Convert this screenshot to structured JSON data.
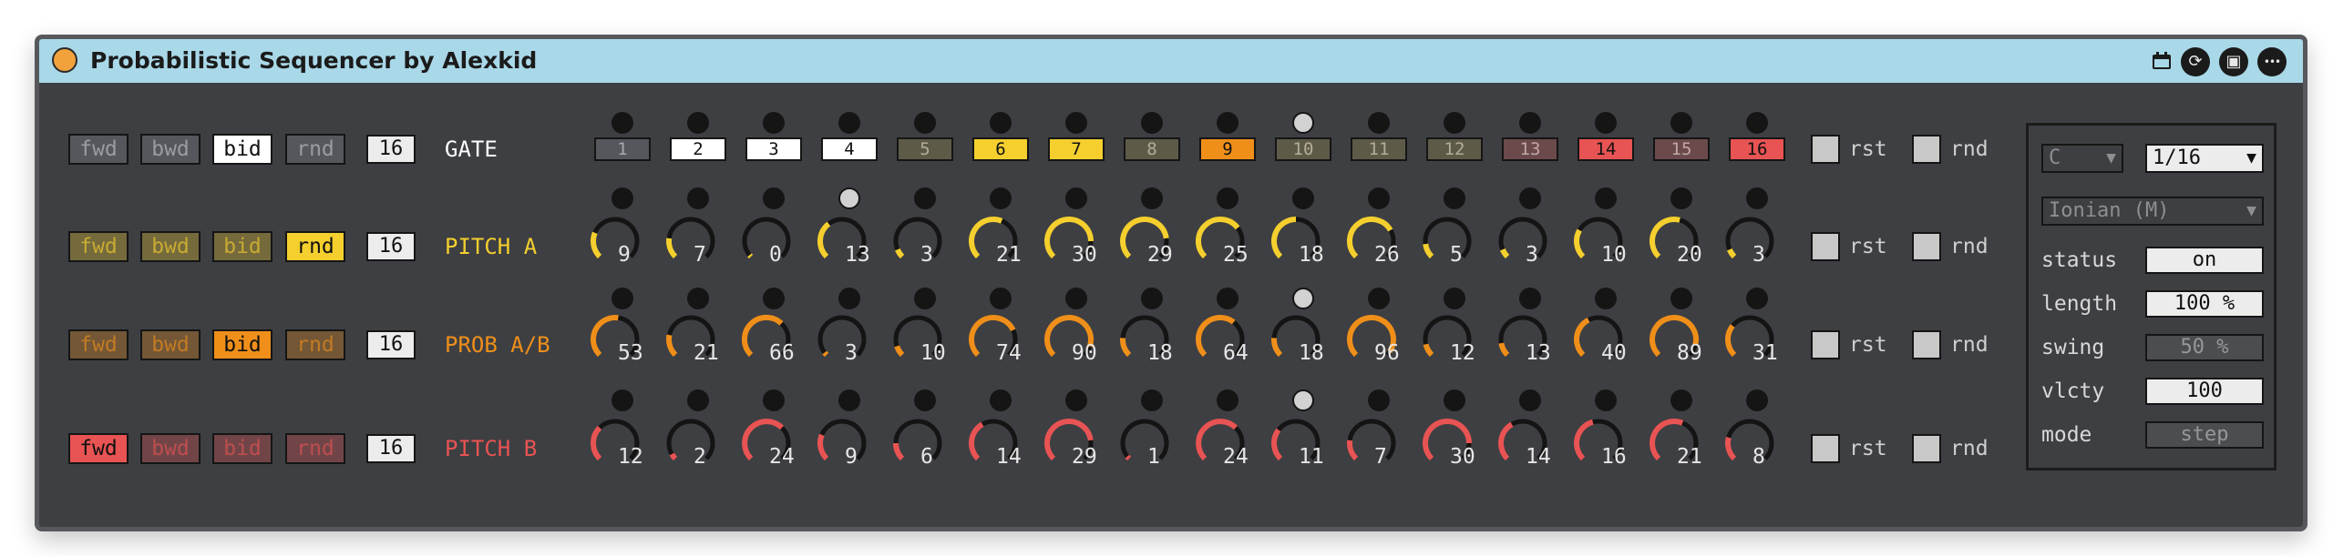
{
  "window": {
    "title": "Probabilistic Sequencer by Alexkid"
  },
  "titlebar_icons": [
    "calendar-icon",
    "sync-icon",
    "save-icon",
    "more-icon"
  ],
  "icon_glyphs": {
    "sync": "⟳",
    "save": "▣",
    "more": "•••"
  },
  "colors": {
    "gate": "#ffffff",
    "pitch_a": "#f4cf2e",
    "prob": "#ef8f1a",
    "pitch_b": "#e85353",
    "knob_track": "#141414",
    "titlebar": "#a9d8e8",
    "panel": "#3e3f42"
  },
  "mode_buttons": [
    "fwd",
    "bwd",
    "bid",
    "rnd"
  ],
  "rows": [
    {
      "id": "gate",
      "name": "GATE",
      "length": "16",
      "active_mode": "bid",
      "steps": [
        "1",
        "2",
        "3",
        "4",
        "5",
        "6",
        "7",
        "8",
        "9",
        "10",
        "11",
        "12",
        "13",
        "14",
        "15",
        "16"
      ],
      "step_states": [
        "off",
        "on",
        "on",
        "on",
        "dim",
        "yellow",
        "yellow",
        "dim",
        "orange",
        "dim",
        "dim",
        "dim",
        "redDim",
        "red",
        "redDim",
        "red"
      ],
      "position_step": 10
    },
    {
      "id": "pitch_a",
      "name": "PITCH A",
      "length": "16",
      "active_mode": "rnd",
      "values": [
        9,
        7,
        0,
        13,
        3,
        21,
        30,
        29,
        25,
        18,
        26,
        5,
        3,
        10,
        20,
        3
      ],
      "max": 36,
      "position_step": 4
    },
    {
      "id": "prob",
      "name": "PROB A/B",
      "length": "16",
      "active_mode": "bid",
      "values": [
        53,
        21,
        66,
        3,
        10,
        74,
        90,
        18,
        64,
        18,
        96,
        12,
        13,
        40,
        89,
        31
      ],
      "max": 100,
      "position_step": 10
    },
    {
      "id": "pitch_b",
      "name": "PITCH B",
      "length": "16",
      "active_mode": "fwd",
      "values": [
        12,
        2,
        24,
        9,
        6,
        14,
        29,
        1,
        24,
        11,
        7,
        30,
        14,
        16,
        21,
        8
      ],
      "max": 36,
      "position_step": 10
    }
  ],
  "row_toggles": {
    "rst_label": "rst",
    "rnd_label": "rnd"
  },
  "settings": {
    "key": "C",
    "rate": "1/16",
    "scale": "Ionian (M)",
    "params": [
      {
        "label": "status",
        "value": "on",
        "enabled": true
      },
      {
        "label": "length",
        "value": "100 %",
        "enabled": true
      },
      {
        "label": "swing",
        "value": "50 %",
        "enabled": false
      },
      {
        "label": "vlcty",
        "value": "100",
        "enabled": true
      },
      {
        "label": "mode",
        "value": "step",
        "enabled": false
      }
    ]
  }
}
